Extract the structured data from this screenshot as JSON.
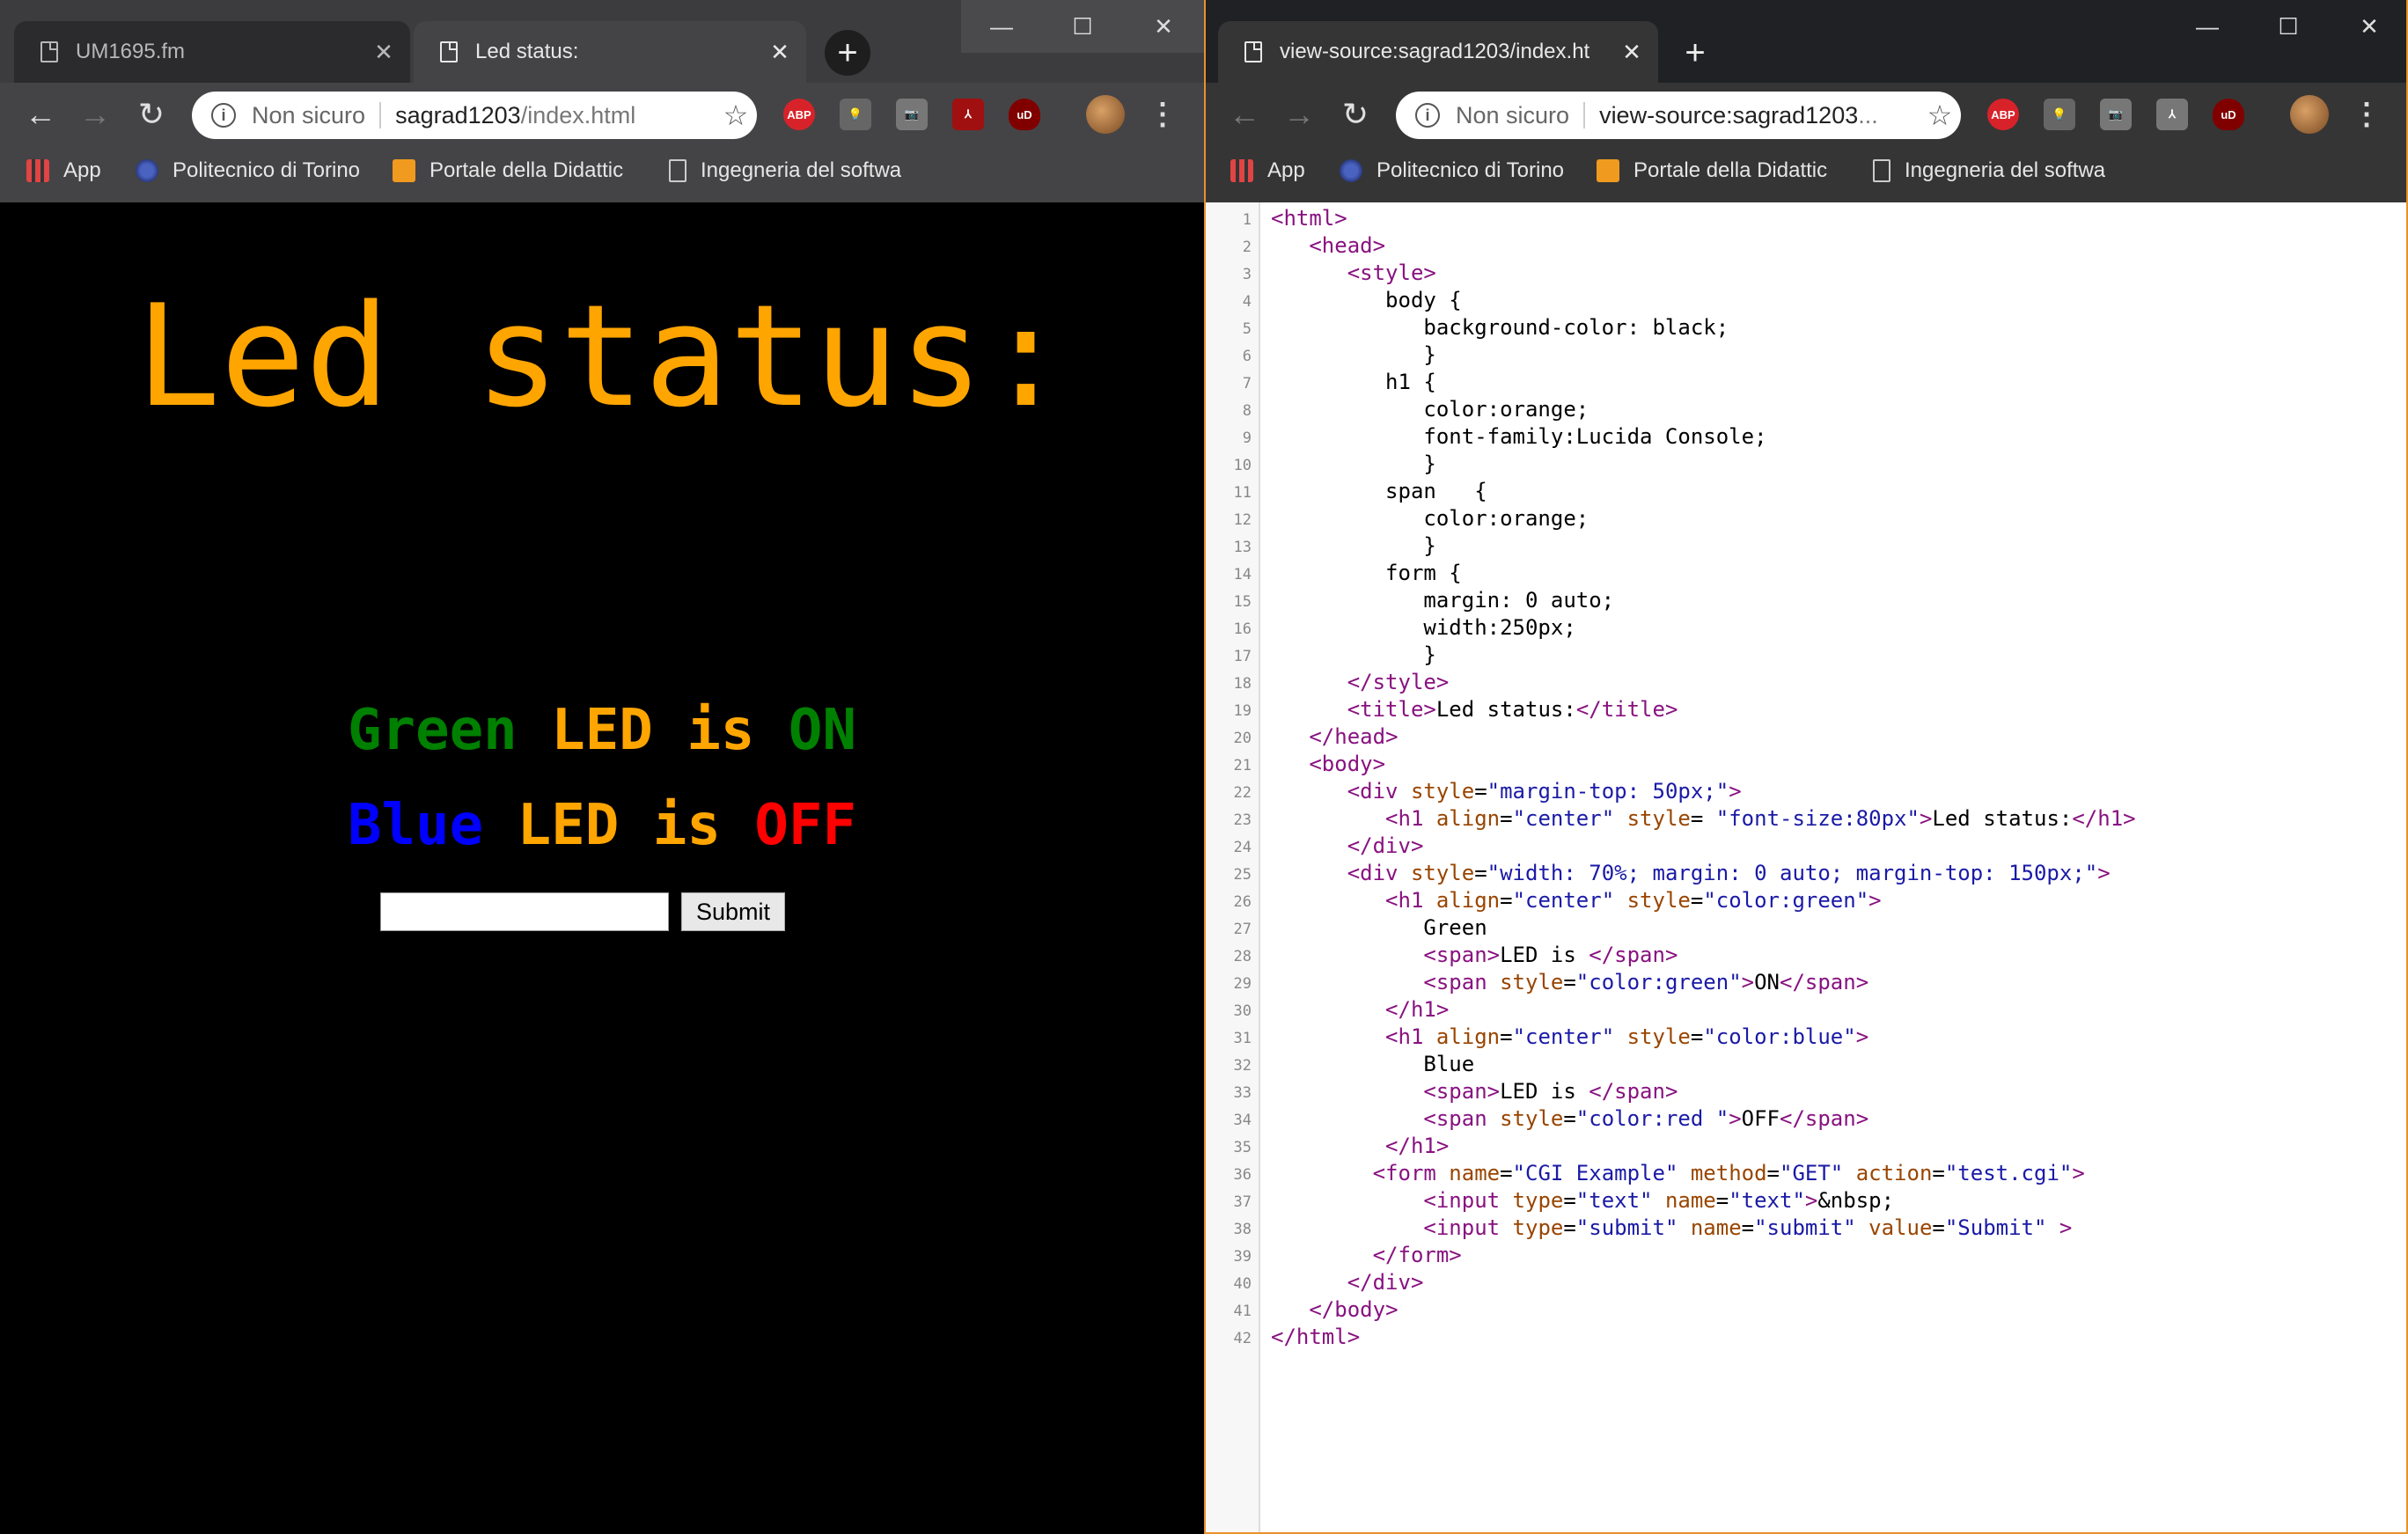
{
  "left_window": {
    "tabs": [
      {
        "title": "UM1695.fm"
      },
      {
        "title": "Led status:"
      }
    ],
    "address": {
      "security": "Non sicuro",
      "host": "sagrad1203",
      "path": "/index.html"
    },
    "bookmarks": [
      "App",
      "Politecnico di Torino",
      "Portale della Didattic",
      "Ingegneria del softwa"
    ],
    "page": {
      "heading": "Led status:",
      "green_line": {
        "color_word": "Green",
        "middle": "LED is",
        "state": "ON"
      },
      "blue_line": {
        "color_word": "Blue",
        "middle": "LED is",
        "state": "OFF"
      },
      "submit_label": "Submit"
    }
  },
  "right_window": {
    "tabs": [
      {
        "title": "view-source:sagrad1203/index.ht"
      }
    ],
    "address": {
      "security": "Non sicuro",
      "host": "view-source:sagrad1203",
      "path": "..."
    },
    "bookmarks": [
      "App",
      "Politecnico di Torino",
      "Portale della Didattic",
      "Ingegneria del softwa"
    ],
    "source_lines": [
      "<html>",
      "   <head>",
      "      <style>",
      "         body {",
      "            background-color: black;",
      "            }",
      "         h1 {",
      "            color:orange;",
      "            font-family:Lucida Console;",
      "            }",
      "         span   {",
      "            color:orange;",
      "            }",
      "         form {",
      "            margin: 0 auto;",
      "            width:250px;",
      "            }",
      "      </style>",
      "      <title>Led status:</title>",
      "   </head>",
      "   <body>",
      "      <div style=\"margin-top: 50px;\">",
      "         <h1 align=\"center\" style= \"font-size:80px\">Led status:</h1>",
      "      </div>",
      "      <div style=\"width: 70%; margin: 0 auto; margin-top: 150px;\">",
      "         <h1 align=\"center\" style=\"color:green\">",
      "            Green",
      "            <span>LED is </span>",
      "            <span style=\"color:green\">ON</span>",
      "         </h1>",
      "         <h1 align=\"center\" style=\"color:blue\">",
      "            Blue",
      "            <span>LED is </span>",
      "            <span style=\"color:red \">OFF</span>",
      "         </h1>",
      "        <form name=\"CGI Example\" method=\"GET\" action=\"test.cgi\">",
      "            <input type=\"text\" name=\"text\">&nbsp;",
      "            <input type=\"submit\" name=\"submit\" value=\"Submit\" >",
      "        </form>",
      "      </div>",
      "   </body>",
      "</html>"
    ]
  }
}
